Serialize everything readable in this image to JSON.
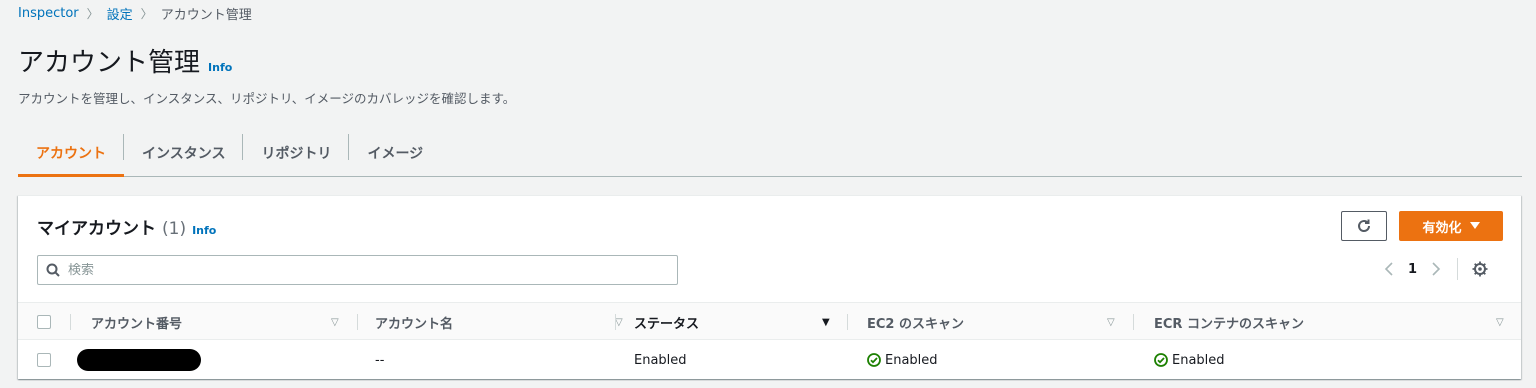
{
  "breadcrumb": {
    "item1": "Inspector",
    "item2": "設定",
    "current": "アカウント管理",
    "separator": "〉"
  },
  "page": {
    "title": "アカウント管理",
    "info": "Info",
    "description": "アカウントを管理し、インスタンス、リポジトリ、イメージのカバレッジを確認します。"
  },
  "tabs": [
    {
      "label": "アカウント",
      "active": true
    },
    {
      "label": "インスタンス",
      "active": false
    },
    {
      "label": "リポジトリ",
      "active": false
    },
    {
      "label": "イメージ",
      "active": false
    }
  ],
  "panel": {
    "title": "マイアカウント",
    "count": "(1)",
    "info": "Info",
    "enable_label": "有効化",
    "search_placeholder": "検索",
    "pagination": {
      "page": "1"
    }
  },
  "table": {
    "columns": [
      "アカウント番号",
      "アカウント名",
      "ステータス",
      "EC2 のスキャン",
      "ECR コンテナのスキャン"
    ],
    "rows": [
      {
        "account_number": "[redacted]",
        "account_name": "--",
        "status": "Enabled",
        "ec2_scan": "Enabled",
        "ecr_scan": "Enabled"
      }
    ]
  },
  "colors": {
    "accent": "#ec7211",
    "link": "#0073bb",
    "success": "#1d8102"
  }
}
